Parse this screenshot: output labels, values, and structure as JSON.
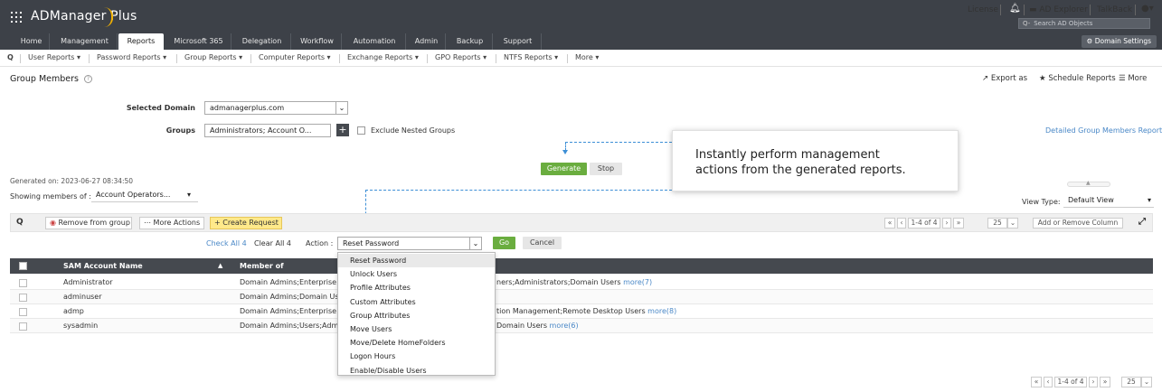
{
  "app": {
    "name": "ADManager Plus"
  },
  "top_links": {
    "license": "License",
    "ad_explorer": "AD Explorer",
    "talkback": "TalkBack",
    "search_placeholder": "Search AD Objects"
  },
  "nav": {
    "tabs": [
      "Home",
      "Management",
      "Reports",
      "Microsoft 365",
      "Delegation",
      "Workflow",
      "Automation",
      "Admin",
      "Backup",
      "Support"
    ],
    "active": "Reports",
    "domain_settings": "Domain Settings"
  },
  "subnav": [
    "User Reports",
    "Password Reports",
    "Group Reports",
    "Computer Reports",
    "Exchange Reports",
    "GPO Reports",
    "NTFS Reports",
    "More"
  ],
  "page": {
    "title": "Group Members",
    "export_label": "Export as",
    "schedule_label": "Schedule Reports",
    "more_label": "More"
  },
  "form": {
    "domain_label": "Selected Domain",
    "domain_value": "admanagerplus.com",
    "groups_label": "Groups",
    "groups_value": "Administrators; Account O...",
    "exclude_nested": "Exclude Nested Groups",
    "detailed_link": "Detailed Group Members Report",
    "generate": "Generate",
    "stop": "Stop"
  },
  "tooltip": {
    "line1": "Instantly perform management",
    "line2": "actions from the generated reports."
  },
  "meta": {
    "generated_on": "Generated on: 2023-06-27 08:34:50",
    "showing_label": "Showing members of :",
    "showing_value": "Account Operators...",
    "view_type_label": "View Type:",
    "view_type_value": "Default View"
  },
  "toolbar": {
    "remove_from_group": "Remove from group",
    "more_actions": "More Actions",
    "create_request": "Create Request",
    "range": "1-4 of 4",
    "page_size": "25",
    "add_remove_column": "Add or Remove Column"
  },
  "action_row": {
    "check_all": "Check All 4",
    "clear_all": "Clear All 4",
    "action_label": "Action :",
    "action_value": "Reset Password",
    "go": "Go",
    "cancel": "Cancel"
  },
  "table": {
    "columns": [
      "SAM Account Name",
      "Member of"
    ],
    "rows": [
      {
        "sam": "Administrator",
        "member_of": "Domain Admins;Enterprise Ac",
        "tail": "ners;Administrators;Domain Users",
        "more": "more(7)"
      },
      {
        "sam": "adminuser",
        "member_of": "Domain Admins;Domain User",
        "tail": "",
        "more": ""
      },
      {
        "sam": "admp",
        "member_of": "Domain Admins;Enterprise Ac",
        "tail": "tion Management;Remote Desktop Users",
        "more": "more(8)"
      },
      {
        "sam": "sysadmin",
        "member_of": "Domain Admins;Users;Admin",
        "tail": "Domain Users",
        "more": "more(6)"
      }
    ]
  },
  "dropdown": {
    "options": [
      "Reset Password",
      "Unlock Users",
      "Profile Attributes",
      "Custom Attributes",
      "Group Attributes",
      "Move Users",
      "Move/Delete HomeFolders",
      "Logon Hours",
      "Enable/Disable Users"
    ]
  },
  "footer": {
    "range": "1-4 of 4",
    "page_size": "25"
  },
  "colors": {
    "header": "#3d4148",
    "accent_green": "#6aad3f",
    "link": "#4a88c7",
    "brand_swoosh": "#f5b301"
  }
}
